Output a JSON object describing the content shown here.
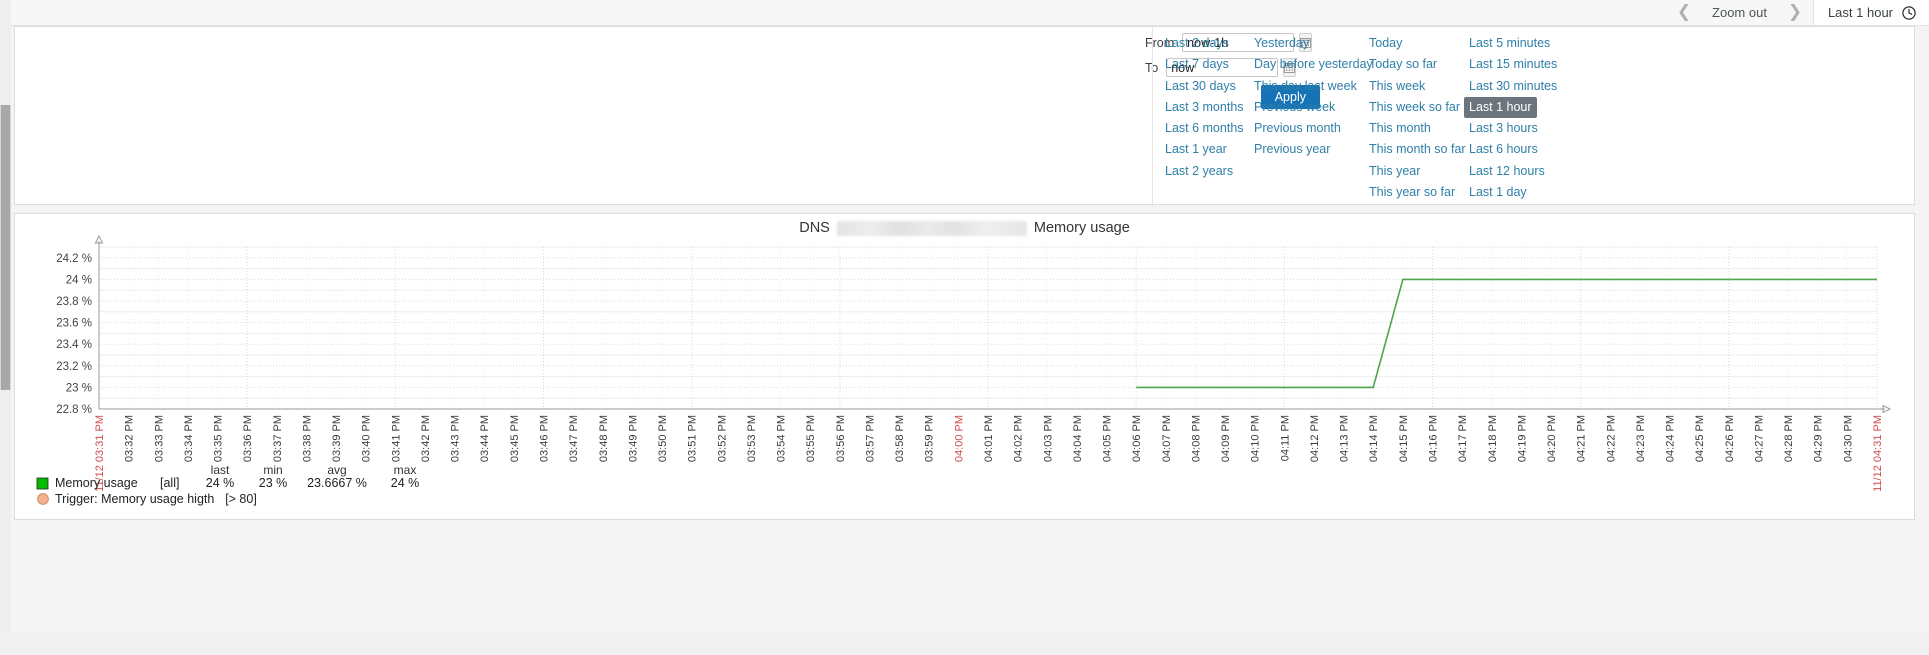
{
  "topbar": {
    "prev_icon": "chevron-left-icon",
    "next_icon": "chevron-right-icon",
    "zoom_out_label": "Zoom out",
    "range_label": "Last 1 hour",
    "clock_icon": "clock-icon"
  },
  "picker": {
    "from_label": "From",
    "from_value": "now-1h",
    "to_label": "To",
    "to_value": "now",
    "calendar_icon": "calendar-icon",
    "apply_label": "Apply",
    "active_range": "Last 1 hour",
    "columns": [
      {
        "items": [
          "Last 2 days",
          "Last 7 days",
          "Last 30 days",
          "Last 3 months",
          "Last 6 months",
          "Last 1 year",
          "Last 2 years"
        ]
      },
      {
        "items": [
          "Yesterday",
          "Day before yesterday",
          "This day last week",
          "Previous week",
          "Previous month",
          "Previous year",
          ""
        ]
      },
      {
        "items": [
          "Today",
          "Today so far",
          "This week",
          "This week so far",
          "This month",
          "This month so far",
          "This year",
          "This year so far"
        ]
      },
      {
        "items": [
          "Last 5 minutes",
          "Last 15 minutes",
          "Last 30 minutes",
          "Last 1 hour",
          "Last 3 hours",
          "Last 6 hours",
          "Last 12 hours",
          "Last 1 day"
        ]
      }
    ]
  },
  "graph": {
    "title_prefix": "DNS",
    "title_suffix": "Memory usage",
    "title_redacted": true,
    "legend": {
      "series_color": "#00bb00",
      "series_name": "Memory usage",
      "scope": "[all]",
      "stat_headers": [
        "last",
        "min",
        "avg",
        "max"
      ],
      "stat_values": [
        "24 %",
        "23 %",
        "23.6667 %",
        "24 %"
      ],
      "trigger_icon": "trigger-circle-icon",
      "trigger_color": "#f3b08a",
      "trigger_label": "Trigger: Memory usage higth",
      "trigger_condition": "[> 80]"
    }
  },
  "chart_data": {
    "type": "line",
    "title": "DNS  Memory usage",
    "xlabel": "",
    "ylabel": "",
    "unit": "%",
    "grid": true,
    "line_color": "#4ca64c",
    "ylim": [
      22.8,
      24.3
    ],
    "yticks": [
      24.2,
      24,
      23.8,
      23.6,
      23.4,
      23.2,
      23,
      22.8
    ],
    "ytick_labels": [
      "24.2 %",
      "24 %",
      "23.8 %",
      "23.6 %",
      "23.4 %",
      "23.2 %",
      "23 %",
      "22.8 %"
    ],
    "x_start_label": "11/12 03:31 PM",
    "x_end_label": "11/12 04:31 PM",
    "x_hour_label": "04:00 PM",
    "xtick_labels": [
      "11/12 03:31 PM",
      "03:32 PM",
      "03:33 PM",
      "03:34 PM",
      "03:35 PM",
      "03:36 PM",
      "03:37 PM",
      "03:38 PM",
      "03:39 PM",
      "03:40 PM",
      "03:41 PM",
      "03:42 PM",
      "03:43 PM",
      "03:44 PM",
      "03:45 PM",
      "03:46 PM",
      "03:47 PM",
      "03:48 PM",
      "03:49 PM",
      "03:50 PM",
      "03:51 PM",
      "03:52 PM",
      "03:53 PM",
      "03:54 PM",
      "03:55 PM",
      "03:56 PM",
      "03:57 PM",
      "03:58 PM",
      "03:59 PM",
      "04:00 PM",
      "04:01 PM",
      "04:02 PM",
      "04:03 PM",
      "04:04 PM",
      "04:05 PM",
      "04:06 PM",
      "04:07 PM",
      "04:08 PM",
      "04:09 PM",
      "04:10 PM",
      "04:11 PM",
      "04:12 PM",
      "04:13 PM",
      "04:14 PM",
      "04:15 PM",
      "04:16 PM",
      "04:17 PM",
      "04:18 PM",
      "04:19 PM",
      "04:20 PM",
      "04:21 PM",
      "04:22 PM",
      "04:23 PM",
      "04:24 PM",
      "04:25 PM",
      "04:26 PM",
      "04:27 PM",
      "04:28 PM",
      "04:29 PM",
      "04:30 PM",
      "11/12 04:31 PM"
    ],
    "series": [
      {
        "name": "Memory usage",
        "x": [
          "04:06 PM",
          "04:07 PM",
          "04:08 PM",
          "04:09 PM",
          "04:10 PM",
          "04:11 PM",
          "04:12 PM",
          "04:13 PM",
          "04:14 PM",
          "04:15 PM",
          "04:16 PM",
          "04:17 PM",
          "04:18 PM",
          "04:19 PM",
          "04:20 PM",
          "04:21 PM",
          "04:22 PM",
          "04:23 PM",
          "04:24 PM",
          "04:25 PM",
          "04:26 PM",
          "04:27 PM",
          "04:28 PM",
          "04:29 PM",
          "04:30 PM",
          "04:31 PM"
        ],
        "values": [
          23,
          23,
          23,
          23,
          23,
          23,
          23,
          23,
          23,
          24,
          24,
          24,
          24,
          24,
          24,
          24,
          24,
          24,
          24,
          24,
          24,
          24,
          24,
          24,
          24,
          24
        ],
        "last": 24,
        "min": 23,
        "avg": 23.6667,
        "max": 24
      }
    ]
  }
}
